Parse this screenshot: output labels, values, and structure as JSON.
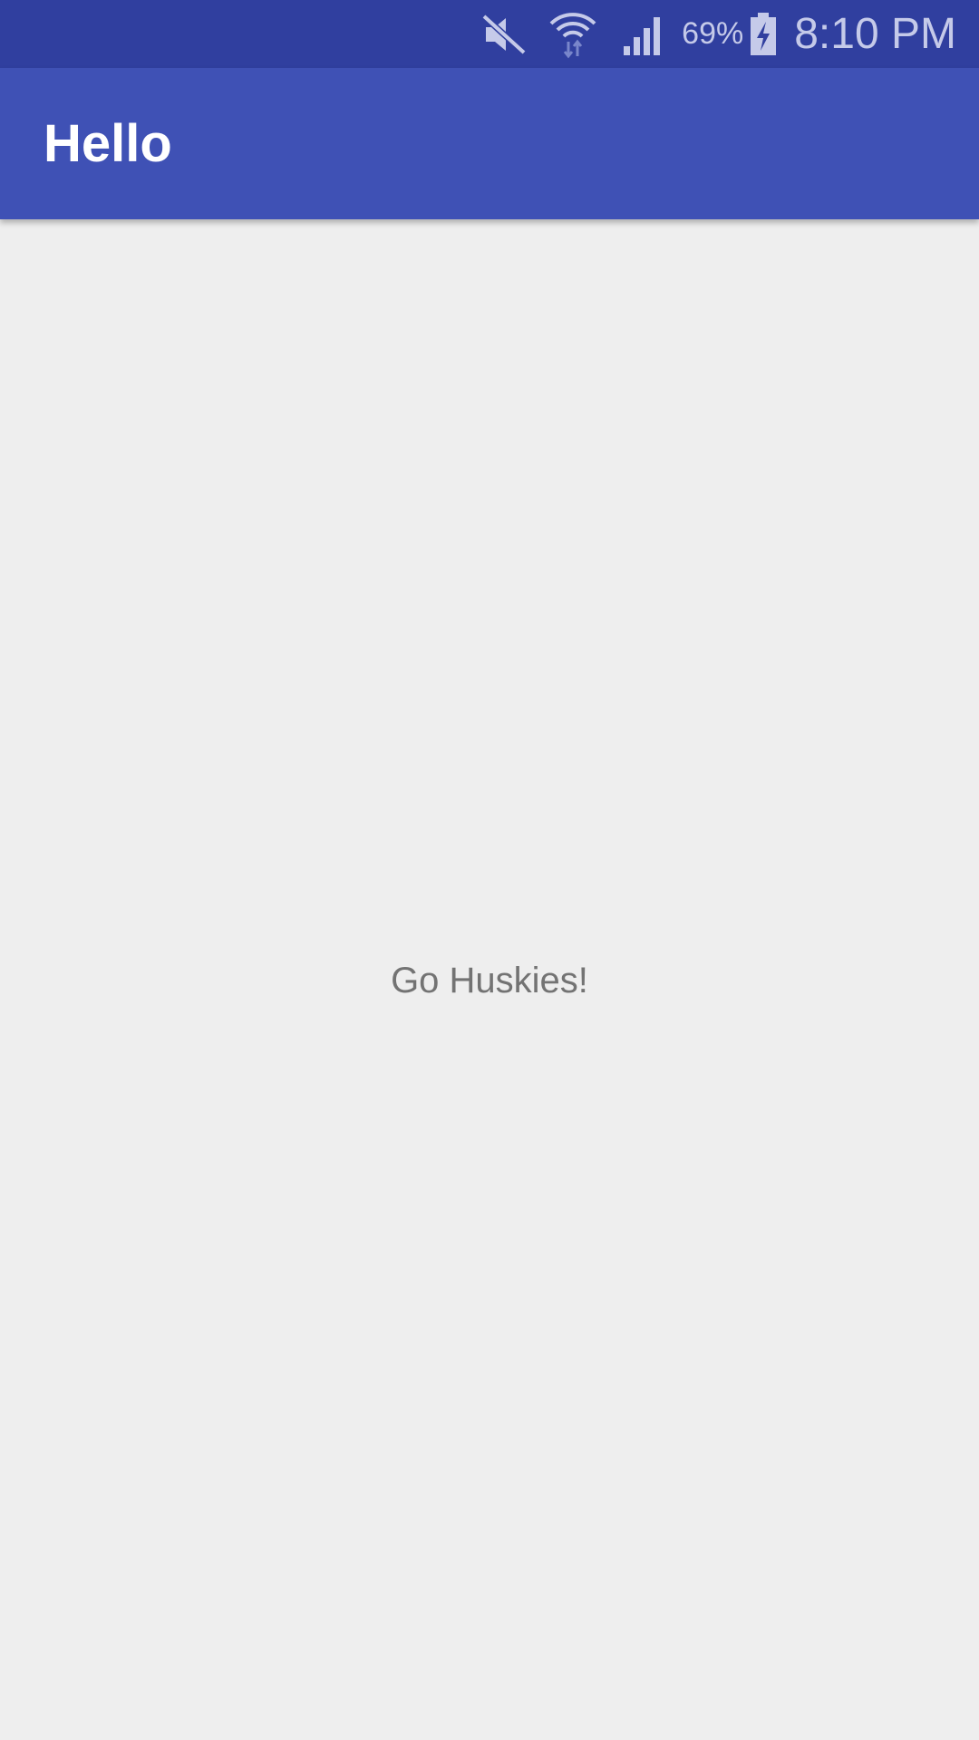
{
  "status_bar": {
    "icons": [
      "mute-icon",
      "wifi-icon",
      "signal-icon",
      "battery-charging-icon"
    ],
    "battery_percent": "69%",
    "time": "8:10 PM",
    "background_color": "#303f9f"
  },
  "app_bar": {
    "title": "Hello",
    "background_color": "#3f51b5"
  },
  "main": {
    "message": "Go Huskies!"
  }
}
